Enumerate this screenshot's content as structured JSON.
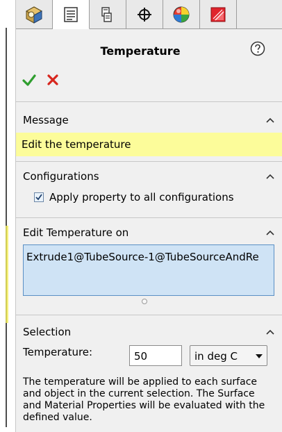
{
  "tabs": [
    {
      "name": "featuremanager",
      "icon": "part-icon"
    },
    {
      "name": "propertymanager",
      "icon": "property-list-icon",
      "active": true
    },
    {
      "name": "configurationmanager",
      "icon": "configuration-icon"
    },
    {
      "name": "dimxpert",
      "icon": "crosshair-icon"
    },
    {
      "name": "display",
      "icon": "appearance-ball-icon"
    },
    {
      "name": "custom",
      "icon": "render-icon"
    }
  ],
  "header": {
    "title": "Temperature"
  },
  "message": {
    "title": "Message",
    "text": "Edit the temperature"
  },
  "configurations": {
    "title": "Configurations",
    "checkbox_label": "Apply property to all configurations",
    "checked": true
  },
  "edit_on": {
    "title": "Edit Temperature on",
    "item": "Extrude1@TubeSource-1@TubeSourceAndRe"
  },
  "selection": {
    "title": "Selection",
    "temperature_label": "Temperature:",
    "temperature_value": "50",
    "unit": "in deg C",
    "description": "The temperature will be applied to each surface and object in the current selection. The Surface and Material Properties will be evaluated with the defined value."
  },
  "colors": {
    "message_bg": "#fcfc9a",
    "selection_bg": "#cfe3f5",
    "ok_green": "#2f9e2f",
    "cancel_red": "#d7261e"
  }
}
